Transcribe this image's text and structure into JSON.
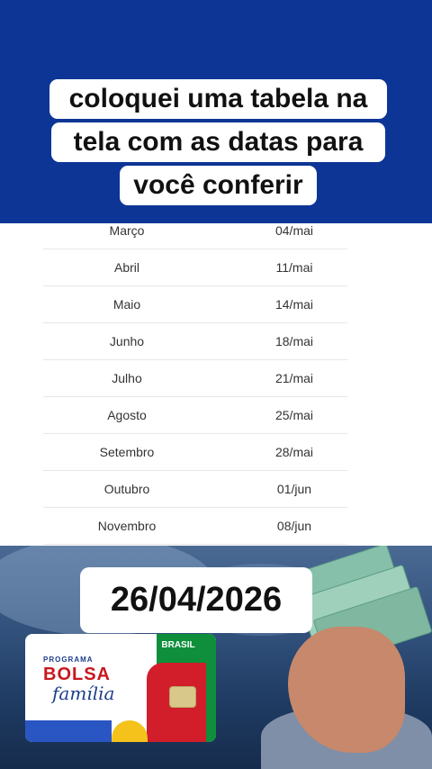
{
  "caption": {
    "line1": "coloquei uma tabela na",
    "line2": "tela com as datas para",
    "line3": "você conferir"
  },
  "table": {
    "rows": [
      {
        "month": "Março",
        "date": "04/mai"
      },
      {
        "month": "Abril",
        "date": "11/mai"
      },
      {
        "month": "Maio",
        "date": "14/mai"
      },
      {
        "month": "Junho",
        "date": "18/mai"
      },
      {
        "month": "Julho",
        "date": "21/mai"
      },
      {
        "month": "Agosto",
        "date": "25/mai"
      },
      {
        "month": "Setembro",
        "date": "28/mai"
      },
      {
        "month": "Outubro",
        "date": "01/jun"
      },
      {
        "month": "Novembro",
        "date": "08/jun"
      }
    ]
  },
  "date_overlay": "26/04/2026",
  "card": {
    "program_label": "PROGRAMA",
    "bolsa": "BOLSA",
    "familia": "família",
    "brasil": "BRASIL"
  },
  "colors": {
    "header_blue": "#0d3596",
    "card_green": "#0f8f3c",
    "card_red": "#d21e2b",
    "card_yellow": "#f4c21a"
  }
}
